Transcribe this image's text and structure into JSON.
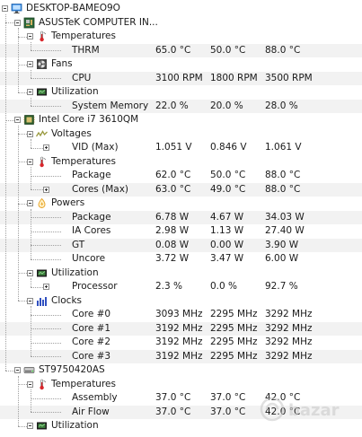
{
  "rows": [
    {
      "kind": "node",
      "level": 0,
      "icon": "monitor",
      "label": "DESKTOP-BAMEO9O"
    },
    {
      "kind": "node",
      "level": 1,
      "icon": "motherboard",
      "label": "ASUSTeK COMPUTER IN..."
    },
    {
      "kind": "node",
      "level": 2,
      "icon": "thermometer",
      "label": "Temperatures"
    },
    {
      "kind": "leaf",
      "level": 3,
      "label": "THRM",
      "v1": "65.0 °C",
      "v2": "50.0 °C",
      "v3": "88.0 °C"
    },
    {
      "kind": "node",
      "level": 2,
      "icon": "fan",
      "label": "Fans"
    },
    {
      "kind": "leaf",
      "level": 3,
      "label": "CPU",
      "v1": "3100 RPM",
      "v2": "1800 RPM",
      "v3": "3500 RPM"
    },
    {
      "kind": "node",
      "level": 2,
      "icon": "chip",
      "label": "Utilization"
    },
    {
      "kind": "leaf",
      "level": 3,
      "label": "System Memory",
      "v1": "22.0 %",
      "v2": "20.0 %",
      "v3": "28.0 %"
    },
    {
      "kind": "node",
      "level": 1,
      "icon": "cpu",
      "label": "Intel Core i7 3610QM"
    },
    {
      "kind": "node",
      "level": 2,
      "icon": "voltage",
      "label": "Voltages"
    },
    {
      "kind": "leaf",
      "level": 3,
      "expandable": true,
      "label": "VID (Max)",
      "v1": "1.051 V",
      "v2": "0.846 V",
      "v3": "1.061 V"
    },
    {
      "kind": "node",
      "level": 2,
      "icon": "thermometer",
      "label": "Temperatures"
    },
    {
      "kind": "leaf",
      "level": 3,
      "label": "Package",
      "v1": "62.0 °C",
      "v2": "50.0 °C",
      "v3": "88.0 °C"
    },
    {
      "kind": "leaf",
      "level": 3,
      "expandable": true,
      "label": "Cores (Max)",
      "v1": "63.0 °C",
      "v2": "49.0 °C",
      "v3": "88.0 °C"
    },
    {
      "kind": "node",
      "level": 2,
      "icon": "power",
      "label": "Powers"
    },
    {
      "kind": "leaf",
      "level": 3,
      "label": "Package",
      "v1": "6.78 W",
      "v2": "4.67 W",
      "v3": "34.03 W"
    },
    {
      "kind": "leaf",
      "level": 3,
      "label": "IA Cores",
      "v1": "2.98 W",
      "v2": "1.13 W",
      "v3": "27.40 W"
    },
    {
      "kind": "leaf",
      "level": 3,
      "label": "GT",
      "v1": "0.08 W",
      "v2": "0.00 W",
      "v3": "3.90 W"
    },
    {
      "kind": "leaf",
      "level": 3,
      "label": "Uncore",
      "v1": "3.72 W",
      "v2": "3.47 W",
      "v3": "6.00 W"
    },
    {
      "kind": "node",
      "level": 2,
      "icon": "chip",
      "label": "Utilization"
    },
    {
      "kind": "leaf",
      "level": 3,
      "expandable": true,
      "label": "Processor",
      "v1": "2.3 %",
      "v2": "0.0 %",
      "v3": "92.7 %"
    },
    {
      "kind": "node",
      "level": 2,
      "icon": "clock",
      "label": "Clocks"
    },
    {
      "kind": "leaf",
      "level": 3,
      "label": "Core #0",
      "v1": "3093 MHz",
      "v2": "2295 MHz",
      "v3": "3292 MHz"
    },
    {
      "kind": "leaf",
      "level": 3,
      "label": "Core #1",
      "v1": "3192 MHz",
      "v2": "2295 MHz",
      "v3": "3292 MHz"
    },
    {
      "kind": "leaf",
      "level": 3,
      "label": "Core #2",
      "v1": "3192 MHz",
      "v2": "2295 MHz",
      "v3": "3292 MHz"
    },
    {
      "kind": "leaf",
      "level": 3,
      "label": "Core #3",
      "v1": "3192 MHz",
      "v2": "2295 MHz",
      "v3": "3292 MHz"
    },
    {
      "kind": "node",
      "level": 1,
      "icon": "hdd",
      "label": "ST9750420AS"
    },
    {
      "kind": "node",
      "level": 2,
      "icon": "thermometer",
      "label": "Temperatures"
    },
    {
      "kind": "leaf",
      "level": 3,
      "label": "Assembly",
      "v1": "37.0 °C",
      "v2": "37.0 °C",
      "v3": "42.0 °C"
    },
    {
      "kind": "leaf",
      "level": 3,
      "label": "Air Flow",
      "v1": "37.0 °C",
      "v2": "37.0 °C",
      "v3": "42.0 °C"
    },
    {
      "kind": "node",
      "level": 2,
      "icon": "chip",
      "label": "Utilization"
    }
  ],
  "icon_colors": {
    "monitor": "#3a8ee6",
    "thermometer": "#d9262b",
    "power": "#e8a020",
    "clock": "#3050c0",
    "voltage": "#9a9a40"
  },
  "watermark": {
    "text": "bazar"
  }
}
